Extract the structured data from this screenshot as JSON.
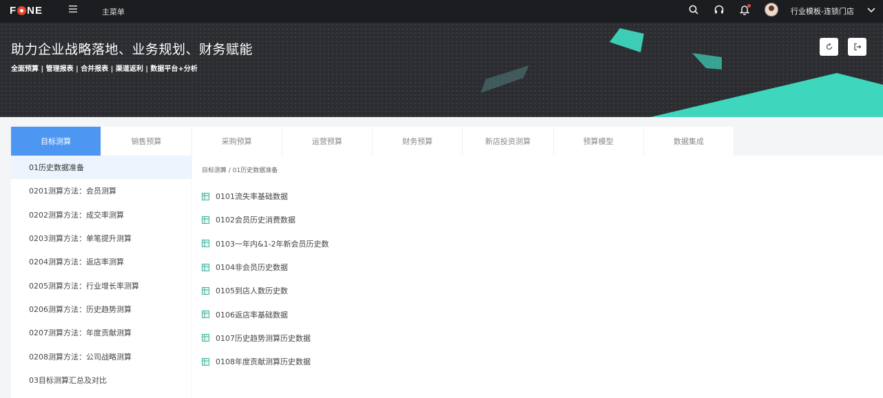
{
  "topbar": {
    "logo": "FONE",
    "main_menu": "主菜单",
    "user_name": "行业模板-连锁门店",
    "icons": [
      "menu-icon",
      "search-icon",
      "headset-icon",
      "bell-icon",
      "chevron-down-icon"
    ]
  },
  "banner": {
    "title": "助力企业战略落地、业务规划、财务赋能",
    "subtitle": "全面预算 | 管理报表 | 合并报表 | 渠道返利 | 数据平台+分析",
    "accent_color": "#3ed6bd",
    "icons": [
      "refresh-icon",
      "logout-icon"
    ]
  },
  "tabs": [
    {
      "label": "目标测算",
      "active": true
    },
    {
      "label": "销售预算",
      "active": false
    },
    {
      "label": "采购预算",
      "active": false
    },
    {
      "label": "运营预算",
      "active": false
    },
    {
      "label": "财务预算",
      "active": false
    },
    {
      "label": "新店投资测算",
      "active": false
    },
    {
      "label": "预算模型",
      "active": false
    },
    {
      "label": "数据集成",
      "active": false
    }
  ],
  "sidebar": {
    "items": [
      {
        "label": "01历史数据准备",
        "active": true
      },
      {
        "label": "0201测算方法：会员测算"
      },
      {
        "label": "0202测算方法：成交率测算"
      },
      {
        "label": "0203测算方法：单笔提升测算"
      },
      {
        "label": "0204测算方法：返店率测算"
      },
      {
        "label": "0205测算方法：行业增长率测算"
      },
      {
        "label": "0206测算方法：历史趋势测算"
      },
      {
        "label": "0207测算方法：年度贡献测算"
      },
      {
        "label": "0208测算方法：公司战略测算"
      },
      {
        "label": "03目标测算汇总及对比"
      }
    ]
  },
  "content": {
    "breadcrumb": "目标测算 / 01历史数据准备",
    "files": [
      "0101流失率基础数据",
      "0102会员历史消费数据",
      "0103一年内&1-2年新会员历史数",
      "0104非会员历史数据",
      "0105到店人数历史数",
      "0106返店率基础数据",
      "0107历史趋势测算历史数据",
      "0108年度贡献测算历史数据"
    ],
    "file_icon_color": "#3fb39a"
  }
}
